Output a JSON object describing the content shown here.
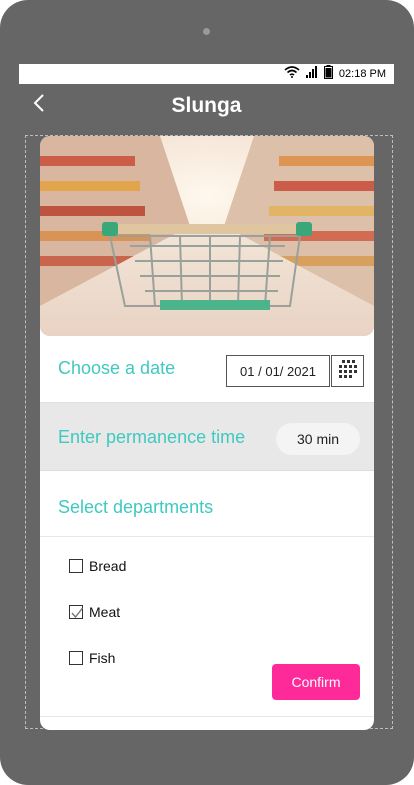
{
  "status_bar": {
    "time": "02:18 PM",
    "icons": [
      "wifi-icon",
      "signal-icon",
      "battery-icon"
    ]
  },
  "app_bar": {
    "title": "Slunga",
    "back_icon": "back-chevron-icon"
  },
  "hero_image": {
    "description_icon": "shopping-cart-aisle-image"
  },
  "date_row": {
    "label": "Choose a date",
    "value": "01 / 01/ 2021",
    "calendar_icon": "calendar-grid-icon"
  },
  "time_row": {
    "label": "Enter permanence time",
    "value": "30 min"
  },
  "departments_row": {
    "label": "Select departments"
  },
  "departments": [
    {
      "label": "Bread",
      "checked": false
    },
    {
      "label": "Meat",
      "checked": true
    },
    {
      "label": "Fish",
      "checked": false
    }
  ],
  "confirm_button": {
    "label": "Confirm"
  },
  "colors": {
    "accent_teal": "#3fc9c0",
    "confirm_pink": "#ff2a9a",
    "device_frame": "#666666"
  }
}
